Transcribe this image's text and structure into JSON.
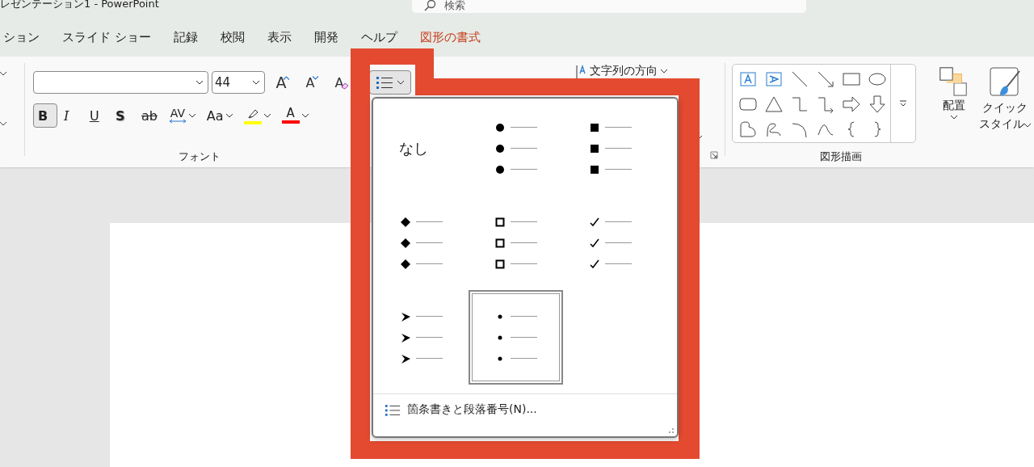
{
  "window": {
    "title": "レゼンテーション1 - PowerPoint"
  },
  "search": {
    "placeholder": "検索"
  },
  "tabs": [
    {
      "label": "ション",
      "selected": false,
      "kind": "normal"
    },
    {
      "label": "スライド ショー",
      "selected": false,
      "kind": "normal"
    },
    {
      "label": "記録",
      "selected": false,
      "kind": "normal"
    },
    {
      "label": "校閲",
      "selected": false,
      "kind": "normal"
    },
    {
      "label": "表示",
      "selected": false,
      "kind": "normal"
    },
    {
      "label": "開発",
      "selected": false,
      "kind": "normal"
    },
    {
      "label": "ヘルプ",
      "selected": false,
      "kind": "normal"
    },
    {
      "label": "図形の書式",
      "selected": false,
      "kind": "contextual"
    }
  ],
  "font_group": {
    "label": "フォント",
    "font_size": "44",
    "size_buttons": [
      {
        "kind": "grow",
        "glyph": "A"
      },
      {
        "kind": "shrink",
        "glyph": "A"
      },
      {
        "kind": "clear",
        "glyph": "A"
      }
    ],
    "format_buttons": [
      {
        "kind": "bold",
        "glyph": "B",
        "pressed": true,
        "dropdown": false
      },
      {
        "kind": "italic",
        "glyph": "I",
        "pressed": false,
        "dropdown": false
      },
      {
        "kind": "underline",
        "glyph": "U",
        "pressed": false,
        "dropdown": false
      },
      {
        "kind": "shadow",
        "glyph": "S",
        "pressed": false,
        "dropdown": false
      },
      {
        "kind": "strikethrough",
        "glyph": "ab",
        "pressed": false,
        "dropdown": false
      },
      {
        "kind": "spacing",
        "glyph": "AV",
        "pressed": false,
        "dropdown": true
      },
      {
        "kind": "case",
        "glyph": "Aa",
        "pressed": false,
        "dropdown": true
      },
      {
        "kind": "highlight",
        "color": "#ffff00",
        "pressed": false,
        "dropdown": true
      },
      {
        "kind": "font-color",
        "glyph": "A",
        "color": "#ff0000",
        "pressed": false,
        "dropdown": true
      }
    ]
  },
  "paragraph_group": {
    "bullets_button": {
      "expanded": true
    },
    "text_direction": "文字列の方向"
  },
  "drawing_group": {
    "label": "図形描画",
    "arrange": "配置",
    "quick_styles": [
      "クイック",
      "スタイル"
    ]
  },
  "bullet_menu": {
    "options": [
      {
        "kind": "none",
        "label": "なし",
        "selected": false
      },
      {
        "kind": "filled-circle",
        "selected": false
      },
      {
        "kind": "filled-square",
        "selected": false
      },
      {
        "kind": "diamond",
        "selected": false
      },
      {
        "kind": "hollow-square",
        "selected": false
      },
      {
        "kind": "check",
        "selected": false
      },
      {
        "kind": "arrowhead",
        "selected": false
      },
      {
        "kind": "small-dot",
        "selected": true
      }
    ],
    "footer": "箇条書きと段落番号(N)..."
  }
}
